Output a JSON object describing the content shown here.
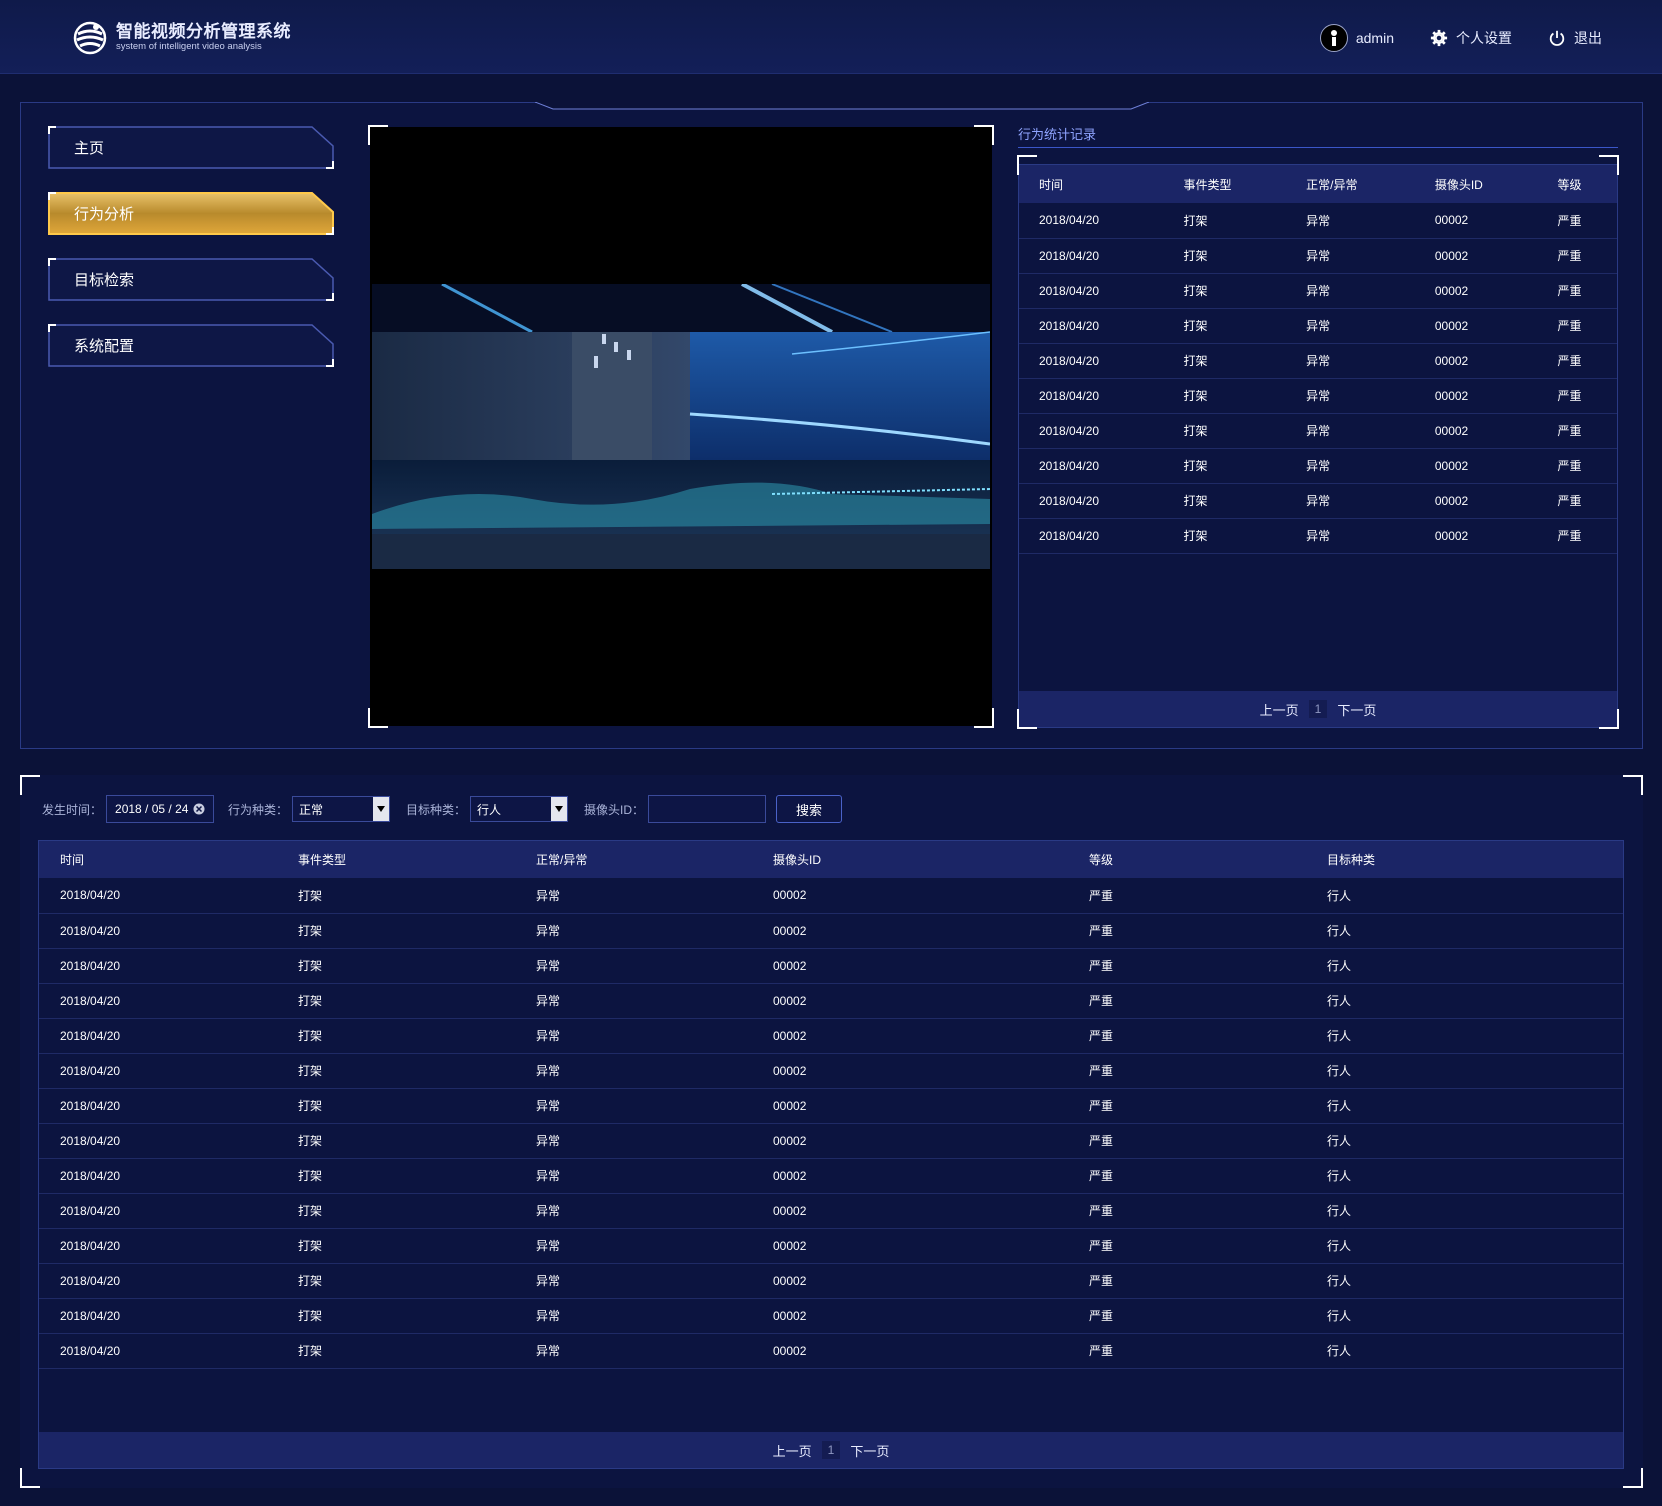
{
  "header": {
    "title": "智能视频分析管理系统",
    "subtitle": "system of intelligent video analysis",
    "username": "admin",
    "settings_label": "个人设置",
    "logout_label": "退出"
  },
  "nav": {
    "items": [
      {
        "label": "主页",
        "active": false
      },
      {
        "label": "行为分析",
        "active": true
      },
      {
        "label": "目标检索",
        "active": false
      },
      {
        "label": "系统配置",
        "active": false
      }
    ]
  },
  "stats": {
    "title": "行为统计记录",
    "columns": [
      "时间",
      "事件类型",
      "正常/异常",
      "摄像头ID",
      "等级"
    ],
    "rows": [
      [
        "2018/04/20",
        "打架",
        "异常",
        "00002",
        "严重"
      ],
      [
        "2018/04/20",
        "打架",
        "异常",
        "00002",
        "严重"
      ],
      [
        "2018/04/20",
        "打架",
        "异常",
        "00002",
        "严重"
      ],
      [
        "2018/04/20",
        "打架",
        "异常",
        "00002",
        "严重"
      ],
      [
        "2018/04/20",
        "打架",
        "异常",
        "00002",
        "严重"
      ],
      [
        "2018/04/20",
        "打架",
        "异常",
        "00002",
        "严重"
      ],
      [
        "2018/04/20",
        "打架",
        "异常",
        "00002",
        "严重"
      ],
      [
        "2018/04/20",
        "打架",
        "异常",
        "00002",
        "严重"
      ],
      [
        "2018/04/20",
        "打架",
        "异常",
        "00002",
        "严重"
      ],
      [
        "2018/04/20",
        "打架",
        "异常",
        "00002",
        "严重"
      ]
    ],
    "pager": {
      "prev": "上一页",
      "page": "1",
      "next": "下一页"
    }
  },
  "filters": {
    "time_label": "发生时间：",
    "time_value": "2018 / 05 / 24",
    "behavior_label": "行为种类：",
    "behavior_value": "正常",
    "target_label": "目标种类：",
    "target_value": "行人",
    "camera_label": "摄像头ID：",
    "camera_value": "",
    "search_label": "搜索"
  },
  "records": {
    "columns": [
      "时间",
      "事件类型",
      "正常/异常",
      "摄像头ID",
      "等级",
      "目标种类"
    ],
    "rows": [
      [
        "2018/04/20",
        "打架",
        "异常",
        "00002",
        "严重",
        "行人"
      ],
      [
        "2018/04/20",
        "打架",
        "异常",
        "00002",
        "严重",
        "行人"
      ],
      [
        "2018/04/20",
        "打架",
        "异常",
        "00002",
        "严重",
        "行人"
      ],
      [
        "2018/04/20",
        "打架",
        "异常",
        "00002",
        "严重",
        "行人"
      ],
      [
        "2018/04/20",
        "打架",
        "异常",
        "00002",
        "严重",
        "行人"
      ],
      [
        "2018/04/20",
        "打架",
        "异常",
        "00002",
        "严重",
        "行人"
      ],
      [
        "2018/04/20",
        "打架",
        "异常",
        "00002",
        "严重",
        "行人"
      ],
      [
        "2018/04/20",
        "打架",
        "异常",
        "00002",
        "严重",
        "行人"
      ],
      [
        "2018/04/20",
        "打架",
        "异常",
        "00002",
        "严重",
        "行人"
      ],
      [
        "2018/04/20",
        "打架",
        "异常",
        "00002",
        "严重",
        "行人"
      ],
      [
        "2018/04/20",
        "打架",
        "异常",
        "00002",
        "严重",
        "行人"
      ],
      [
        "2018/04/20",
        "打架",
        "异常",
        "00002",
        "严重",
        "行人"
      ],
      [
        "2018/04/20",
        "打架",
        "异常",
        "00002",
        "严重",
        "行人"
      ],
      [
        "2018/04/20",
        "打架",
        "异常",
        "00002",
        "严重",
        "行人"
      ]
    ],
    "pager": {
      "prev": "上一页",
      "page": "1",
      "next": "下一页"
    }
  },
  "colors": {
    "background": "#0b1238",
    "panel": "#0c1440",
    "table_header": "#1b2566",
    "accent_gold": "#f2b73a",
    "accent_blue": "#8fa4ff"
  },
  "icons": [
    "logo-icon",
    "avatar-icon",
    "gear-icon",
    "power-icon",
    "dropdown-arrow-icon",
    "clear-icon"
  ]
}
